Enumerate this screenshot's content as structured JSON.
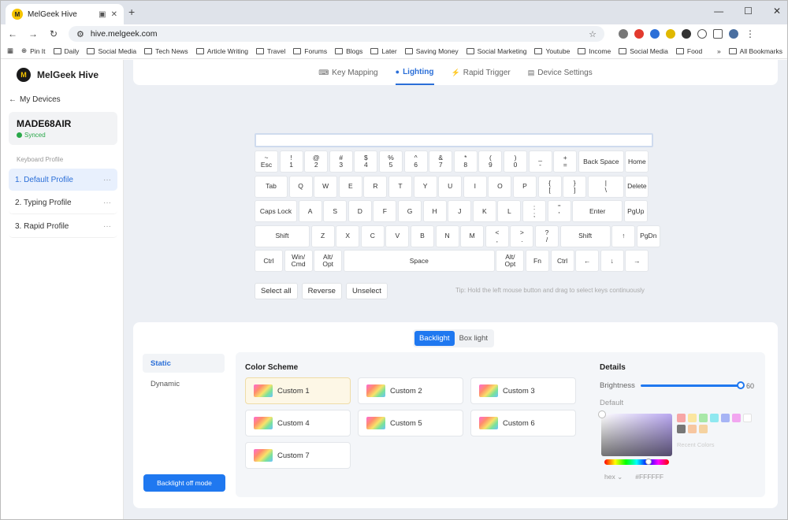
{
  "browser": {
    "tab_title": "MelGeek Hive",
    "new_tab": "+",
    "url": "hive.melgeek.com",
    "bookmarks": [
      "Pin It",
      "Daily",
      "Social Media",
      "Tech News",
      "Article Writing",
      "Travel",
      "Forums",
      "Blogs",
      "Later",
      "Saving Money",
      "Social Marketing",
      "Youtube",
      "Income",
      "Social Media",
      "Food"
    ],
    "all_bookmarks": "All Bookmarks",
    "more": "»"
  },
  "app": {
    "brand": "MelGeek Hive",
    "back_label": "My Devices",
    "device": {
      "name": "MADE68AIR",
      "status": "Synced"
    },
    "profile_section_label": "Keyboard Profile",
    "profiles": [
      {
        "label": "1. Default Profile",
        "active": true
      },
      {
        "label": "2. Typing Profile",
        "active": false
      },
      {
        "label": "3. Rapid Profile",
        "active": false
      }
    ],
    "nav": {
      "key_mapping": "Key Mapping",
      "lighting": "Lighting",
      "rapid_trigger": "Rapid Trigger",
      "device_settings": "Device Settings"
    }
  },
  "keyboard": {
    "rows": [
      [
        [
          "~",
          "Esc"
        ],
        [
          "!",
          "1"
        ],
        [
          "@",
          "2"
        ],
        [
          "#",
          "3"
        ],
        [
          "$",
          "4"
        ],
        [
          "%",
          "5"
        ],
        [
          "^",
          "6"
        ],
        [
          "&",
          "7"
        ],
        [
          "*",
          "8"
        ],
        [
          "(",
          "9"
        ],
        [
          ")",
          "0"
        ],
        [
          "_",
          "-"
        ],
        [
          "+",
          "="
        ],
        [
          "Back Space"
        ],
        [
          "Home"
        ]
      ],
      [
        [
          "Tab"
        ],
        [
          "Q"
        ],
        [
          "W"
        ],
        [
          "E"
        ],
        [
          "R"
        ],
        [
          "T"
        ],
        [
          "Y"
        ],
        [
          "U"
        ],
        [
          "I"
        ],
        [
          "O"
        ],
        [
          "P"
        ],
        [
          "{",
          "["
        ],
        [
          "}",
          "]"
        ],
        [
          "|",
          "\\"
        ],
        [
          "Delete"
        ]
      ],
      [
        [
          "Caps Lock"
        ],
        [
          "A"
        ],
        [
          "S"
        ],
        [
          "D"
        ],
        [
          "F"
        ],
        [
          "G"
        ],
        [
          "H"
        ],
        [
          "J"
        ],
        [
          "K"
        ],
        [
          "L"
        ],
        [
          ":",
          ";"
        ],
        [
          "\"",
          "'"
        ],
        [
          "Enter"
        ],
        [
          "PgUp"
        ]
      ],
      [
        [
          "Shift"
        ],
        [
          "Z"
        ],
        [
          "X"
        ],
        [
          "C"
        ],
        [
          "V"
        ],
        [
          "B"
        ],
        [
          "N"
        ],
        [
          "M"
        ],
        [
          "<",
          ","
        ],
        [
          ">",
          "."
        ],
        [
          "?",
          "/"
        ],
        [
          "Shift"
        ],
        [
          "↑"
        ],
        [
          "PgDn"
        ]
      ],
      [
        [
          "Ctrl"
        ],
        [
          "Win/",
          "Cmd"
        ],
        [
          "Alt/",
          "Opt"
        ],
        [
          "Space"
        ],
        [
          "Alt/",
          "Opt"
        ],
        [
          "Fn"
        ],
        [
          "Ctrl"
        ],
        [
          "←"
        ],
        [
          "↓"
        ],
        [
          "→"
        ]
      ]
    ],
    "buttons": {
      "select_all": "Select all",
      "reverse": "Reverse",
      "unselect": "Unselect"
    },
    "tip": "Tip: Hold the left mouse button and drag to select keys continuously"
  },
  "lighting": {
    "segments": {
      "backlight": "Backlight",
      "box_light": "Box light"
    },
    "modes": {
      "static": "Static",
      "dynamic": "Dynamic"
    },
    "off_button": "Backlight off mode",
    "color_scheme_title": "Color Scheme",
    "schemes": [
      "Custom 1",
      "Custom 2",
      "Custom 3",
      "Custom 4",
      "Custom 5",
      "Custom 6",
      "Custom 7"
    ],
    "active_scheme": "Custom 1",
    "details": {
      "title": "Details",
      "brightness_label": "Brightness",
      "brightness_value": "60",
      "brightness_fraction": 0.6,
      "default_label": "Default",
      "hex_label": "hex",
      "hex_value": "#FFFFFF",
      "recent_label": "Recent Colors",
      "preset_colors": [
        "#f7a6a6",
        "#fbe6a0",
        "#a8e8a8",
        "#8fe8f0",
        "#a6b4f5",
        "#f2a6f0",
        "#ffffff",
        "#777777",
        "#f7c6a0",
        "#f5d2a0"
      ]
    }
  },
  "colors": {
    "accent": "#1f78f0",
    "active_scheme_bg": "#fdf7e6"
  }
}
